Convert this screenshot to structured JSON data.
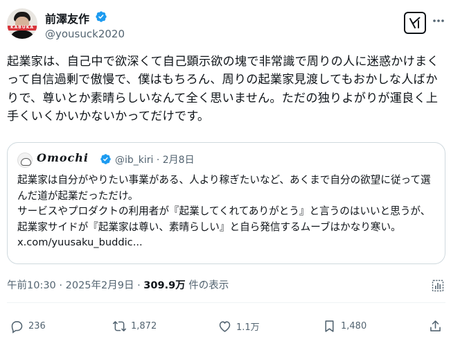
{
  "author": {
    "display_name": "前澤友作",
    "handle": "@yousuck2020",
    "avatar_tag": "KABUKA"
  },
  "tweet": {
    "text": "起業家は、自己中で欲深くて自己顕示欲の塊で非常識で周りの人に迷惑かけまくって自信過剰で傲慢で、僕はもちろん、周りの起業家見渡してもおかしな人ばかりで、尊いとか素晴らしいなんて全く思いません。ただの独りよがりが運良く上手くいくかいかないかってだけです。"
  },
  "quote": {
    "display_name": "Omochi",
    "handle_date": "@ib_kiri · 2月8日",
    "text_line1": "起業家は自分がやりたい事業がある、人より稼ぎたいなど、あくまで自分の欲望に従って選んだ道が起業だっただけ。",
    "text_line2": "サービスやプロダクトの利用者が『起業してくれてありがとう』と言うのはいいと思うが、起業家サイドが『起業家は尊い、素晴らしい』と自ら発信するムーブはかなり寒い。 x.com/yuusaku_buddic..."
  },
  "meta": {
    "time_date": "午前10:30 · 2025年2月9日 · ",
    "views_count": "309.9万",
    "views_label": " 件の表示"
  },
  "actions": {
    "replies": "236",
    "reposts": "1,872",
    "likes": "1.1万",
    "bookmarks": "1,480"
  },
  "colors": {
    "verified": "#1d9bf0",
    "text_primary": "#0f1419",
    "text_secondary": "#536471",
    "border": "#cfd9de"
  },
  "icons": [
    "verified-badge-icon",
    "grok-icon",
    "more-icon",
    "analytics-icon",
    "reply-icon",
    "repost-icon",
    "like-icon",
    "bookmark-icon",
    "share-icon"
  ]
}
